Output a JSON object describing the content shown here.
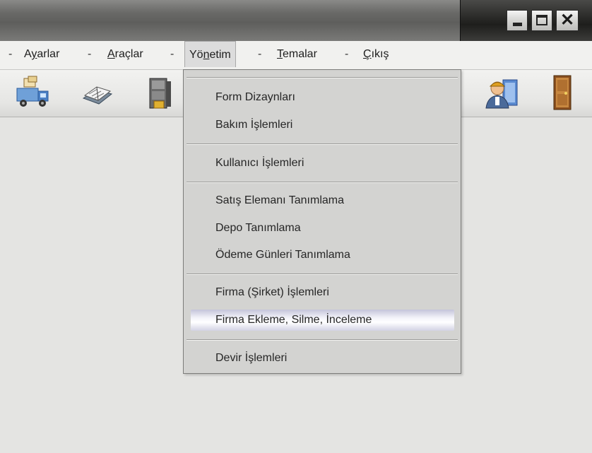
{
  "window": {
    "minimize_icon": "minimize-icon",
    "maximize_icon": "maximize-icon",
    "close_glyph": "✕"
  },
  "menubar": {
    "separator": "-",
    "items": [
      {
        "prefix": "A",
        "accel": "y",
        "rest": "arlar"
      },
      {
        "prefix": "",
        "accel": "A",
        "rest": "raçlar"
      },
      {
        "prefix": "Yö",
        "accel": "n",
        "rest": "etim"
      },
      {
        "prefix": "",
        "accel": "T",
        "rest": "emalar"
      },
      {
        "prefix": "",
        "accel": "Ç",
        "rest": "ıkış"
      }
    ],
    "open_menu": "Yönetim"
  },
  "toolbar": {
    "icons": [
      "delivery-truck-icon",
      "book-icon",
      "cabinet-icon",
      "worker-icon",
      "exit-door-icon"
    ]
  },
  "dropdown": {
    "items": [
      "Form Dizaynları",
      "Bakım İşlemleri",
      "Kullanıcı İşlemleri",
      "Satış Elemanı Tanımlama",
      "Depo Tanımlama",
      "Ödeme Günleri Tanımlama",
      "Firma (Şirket) İşlemleri",
      "Firma Ekleme, Silme, İnceleme",
      "Devir İşlemleri"
    ],
    "highlighted_item": "Firma Ekleme, Silme, İnceleme"
  },
  "colors": {
    "menubar_bg": "#f1f1ef",
    "dropdown_bg": "#d3d3d1",
    "workspace_bg": "#e4e4e2",
    "highlight": "#f4f4fa"
  }
}
